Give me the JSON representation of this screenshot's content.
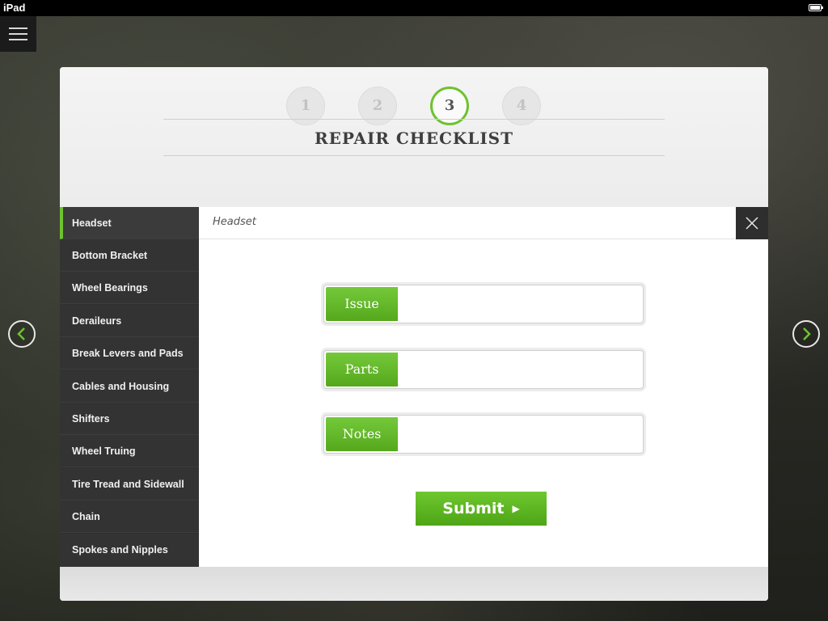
{
  "status_bar": {
    "device": "iPad"
  },
  "steps": [
    "1",
    "2",
    "3",
    "4"
  ],
  "active_step": "3",
  "title": "REPAIR CHECKLIST",
  "sidebar": {
    "items": [
      {
        "label": "Headset"
      },
      {
        "label": "Bottom Bracket"
      },
      {
        "label": "Wheel Bearings"
      },
      {
        "label": "Deraileurs"
      },
      {
        "label": "Break Levers and Pads"
      },
      {
        "label": "Cables and Housing"
      },
      {
        "label": "Shifters"
      },
      {
        "label": "Wheel Truing"
      },
      {
        "label": "Tire Tread and Sidewall"
      },
      {
        "label": "Chain"
      },
      {
        "label": "Spokes and Nipples"
      }
    ],
    "active": "Headset"
  },
  "content": {
    "title": "Headset",
    "fields": [
      {
        "label": "Issue",
        "value": ""
      },
      {
        "label": "Parts",
        "value": ""
      },
      {
        "label": "Notes",
        "value": ""
      }
    ],
    "submit_label": "Submit"
  },
  "icons": {
    "menu": "hamburger-menu-icon",
    "prev": "chevron-left-circle-icon",
    "next": "chevron-right-circle-icon",
    "close": "close-icon",
    "submit": "triangle-right-icon",
    "battery": "battery-icon"
  },
  "colors": {
    "accent": "#6fc22f",
    "sidebar_bg": "#333333",
    "panel_bg": "#eeeeee"
  }
}
